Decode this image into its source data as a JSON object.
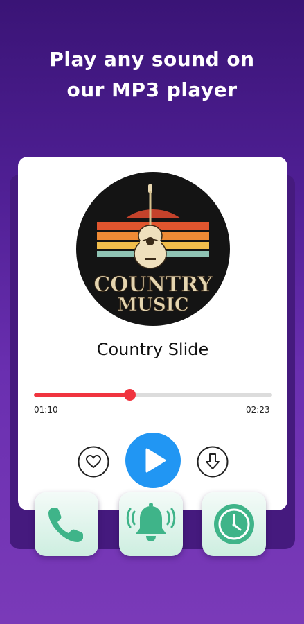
{
  "headline": {
    "line1": "Play any sound on",
    "line2": "our MP3 player"
  },
  "player": {
    "album_art": {
      "text_line1": "COUNTRY",
      "text_line2": "MUSIC"
    },
    "track_title": "Country Slide",
    "progress": {
      "elapsed": "01:10",
      "total": "02:23",
      "fraction": 0.4
    },
    "controls": [
      {
        "name": "favorite",
        "icon": "heart-outline-icon"
      },
      {
        "name": "play",
        "icon": "play-icon"
      },
      {
        "name": "download",
        "icon": "download-arrow-icon"
      }
    ]
  },
  "feature_tiles": [
    {
      "name": "call",
      "icon": "phone-icon"
    },
    {
      "name": "alarm",
      "icon": "bell-ringing-icon"
    },
    {
      "name": "timer",
      "icon": "clock-icon"
    }
  ],
  "colors": {
    "background_top": "#3a1476",
    "background_bottom": "#7a3ab8",
    "card": "#ffffff",
    "progress_accent": "#f0343f",
    "play_button": "#2196f3",
    "tile_icon_green": "#3fb489"
  }
}
